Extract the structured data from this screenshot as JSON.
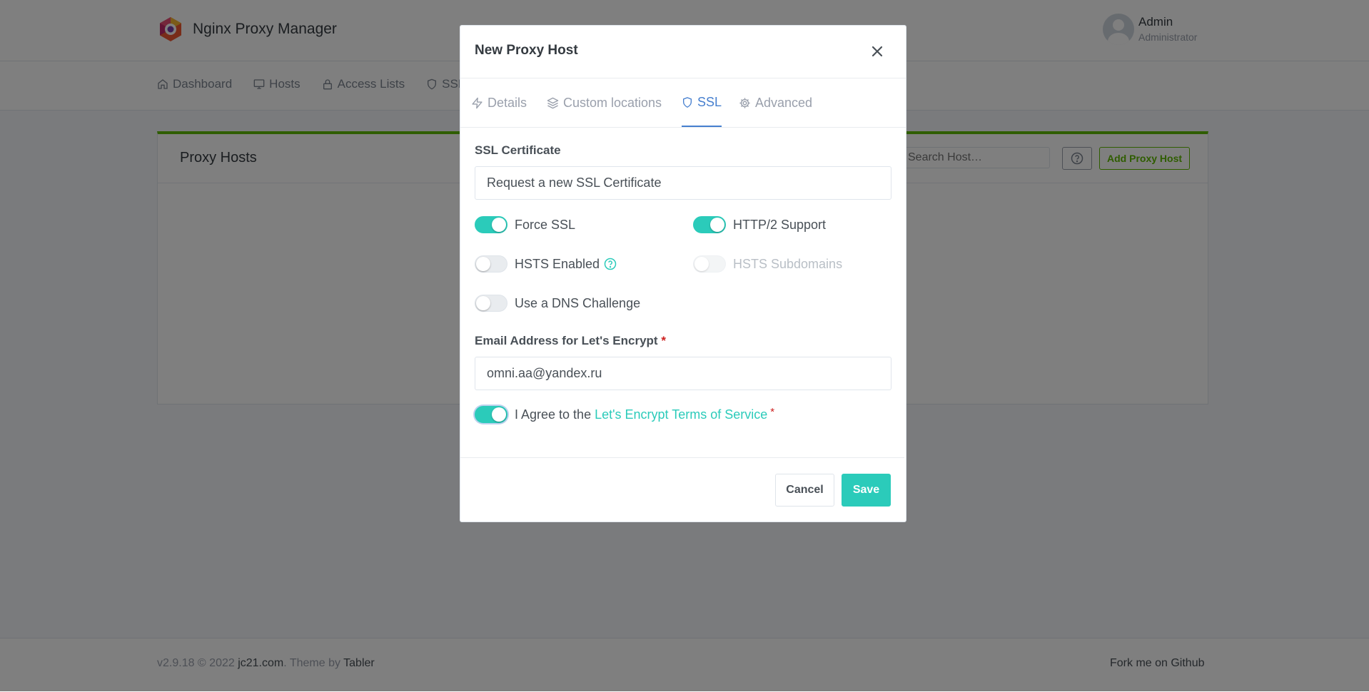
{
  "app": {
    "title": "Nginx Proxy Manager",
    "user_name": "Admin",
    "user_role": "Administrator"
  },
  "nav": {
    "items": [
      {
        "label": "Dashboard",
        "icon": "home-icon"
      },
      {
        "label": "Hosts",
        "icon": "monitor-icon"
      },
      {
        "label": "Access Lists",
        "icon": "lock-icon"
      },
      {
        "label": "SSL",
        "icon": "shield-icon"
      }
    ]
  },
  "card": {
    "title": "Proxy Hosts",
    "search_placeholder": "Search Host…",
    "add_label": "Add Proxy Host"
  },
  "footer": {
    "version": "v2.9.18 © 2022 ",
    "company": "jc21.com",
    "theme_text": ". Theme by ",
    "theme_link": "Tabler",
    "fork": "Fork me on Github"
  },
  "modal": {
    "title": "New Proxy Host",
    "tabs": [
      {
        "label": "Details",
        "icon": "zap-icon"
      },
      {
        "label": "Custom locations",
        "icon": "layers-icon"
      },
      {
        "label": "SSL",
        "icon": "shield-icon",
        "active": true
      },
      {
        "label": "Advanced",
        "icon": "gear-icon"
      }
    ],
    "ssl_certificate": {
      "label": "SSL Certificate",
      "value": "Request a new SSL Certificate"
    },
    "switches": {
      "force_ssl": {
        "label": "Force SSL",
        "on": true
      },
      "http2": {
        "label": "HTTP/2 Support",
        "on": true
      },
      "hsts": {
        "label": "HSTS Enabled",
        "on": false
      },
      "hsts_subdomains": {
        "label": "HSTS Subdomains",
        "on": false,
        "disabled": true
      },
      "dns_challenge": {
        "label": "Use a DNS Challenge",
        "on": false
      },
      "agree": {
        "label": "I Agree to the",
        "link": "Let's Encrypt Terms of Service",
        "on": true
      }
    },
    "email": {
      "label": "Email Address for Let's Encrypt",
      "value": "omni.aa@yandex.ru"
    },
    "required_mark": "*",
    "cancel_label": "Cancel",
    "save_label": "Save"
  },
  "colors": {
    "accent": "#2bcbba",
    "tab_active": "#467fcf",
    "card_border": "#5eba00",
    "required": "#cd201f"
  }
}
